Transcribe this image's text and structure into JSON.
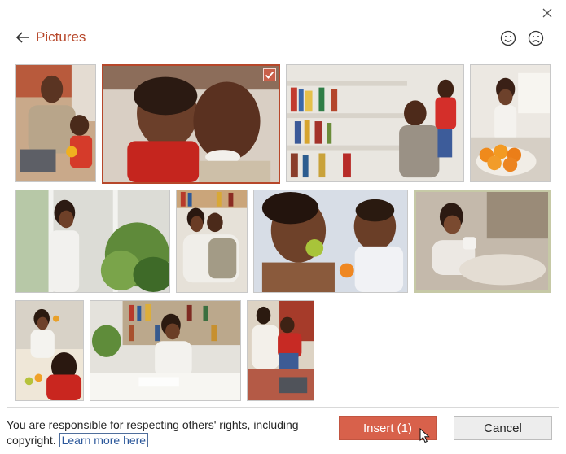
{
  "dialog": {
    "title": "Pictures",
    "close_icon": "close-icon",
    "back_icon": "arrow-left-icon",
    "feedback": {
      "smile_icon": "smile-icon",
      "frown_icon": "frown-icon"
    }
  },
  "gallery": {
    "selected_index": 1,
    "check_icon": "checkmark-icon",
    "images": [
      {
        "subject": "father-child-laptop",
        "selected": false
      },
      {
        "subject": "father-child-closeup",
        "selected": true
      },
      {
        "subject": "father-child-bookshelf",
        "selected": false
      },
      {
        "subject": "woman-kitchen-oranges",
        "selected": false
      },
      {
        "subject": "woman-window-plants",
        "selected": false
      },
      {
        "subject": "couple-embrace",
        "selected": false
      },
      {
        "subject": "mother-baby-apple",
        "selected": false
      },
      {
        "subject": "woman-cup-blurred",
        "selected": false
      },
      {
        "subject": "mother-child-table",
        "selected": false
      },
      {
        "subject": "woman-writing-desk",
        "selected": false
      },
      {
        "subject": "mother-child-laptop-chair",
        "selected": false
      }
    ]
  },
  "footer": {
    "notice_text": "You are responsible for respecting others' rights, including copyright.",
    "learn_more": "Learn more here",
    "insert_label": "Insert (1)",
    "cancel_label": "Cancel"
  },
  "colors": {
    "accent": "#b7472a",
    "insert_button": "#d8614b",
    "cancel_button": "#ededed",
    "link": "#2b579a"
  }
}
